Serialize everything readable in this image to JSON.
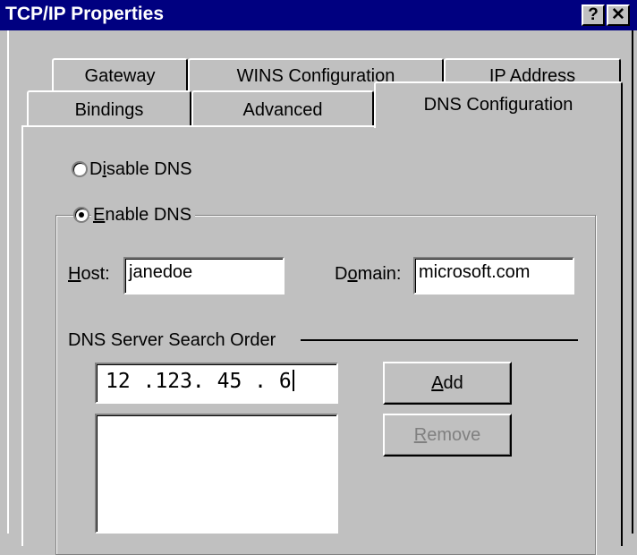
{
  "window": {
    "title": "TCP/IP Properties",
    "help_glyph": "?",
    "close_glyph": "✕"
  },
  "tabs": {
    "row1": [
      "Gateway",
      "WINS Configuration",
      "IP Address"
    ],
    "row2": [
      "Bindings",
      "Advanced",
      "DNS Configuration"
    ],
    "active": "DNS Configuration"
  },
  "dns": {
    "disable": {
      "pre": "D",
      "mnemonic": "i",
      "post": "sable DNS",
      "selected": false
    },
    "enable": {
      "mnemonic": "E",
      "post": "nable DNS",
      "selected": true
    },
    "host": {
      "mnemonic": "H",
      "post": "ost:",
      "value": "janedoe"
    },
    "domain": {
      "pre": "D",
      "mnemonic": "o",
      "post": "main:",
      "value": "microsoft.com"
    },
    "search_order_label": "DNS Server Search Order",
    "ip_entry": "12 .123. 45 . 6",
    "server_list": [],
    "add": {
      "mnemonic": "A",
      "post": "dd",
      "enabled": true
    },
    "remove": {
      "mnemonic": "R",
      "post": "emove",
      "enabled": false
    }
  },
  "colors": {
    "titlebar": "#000080",
    "face": "#c0c0c0",
    "disabled_text": "#808080"
  }
}
